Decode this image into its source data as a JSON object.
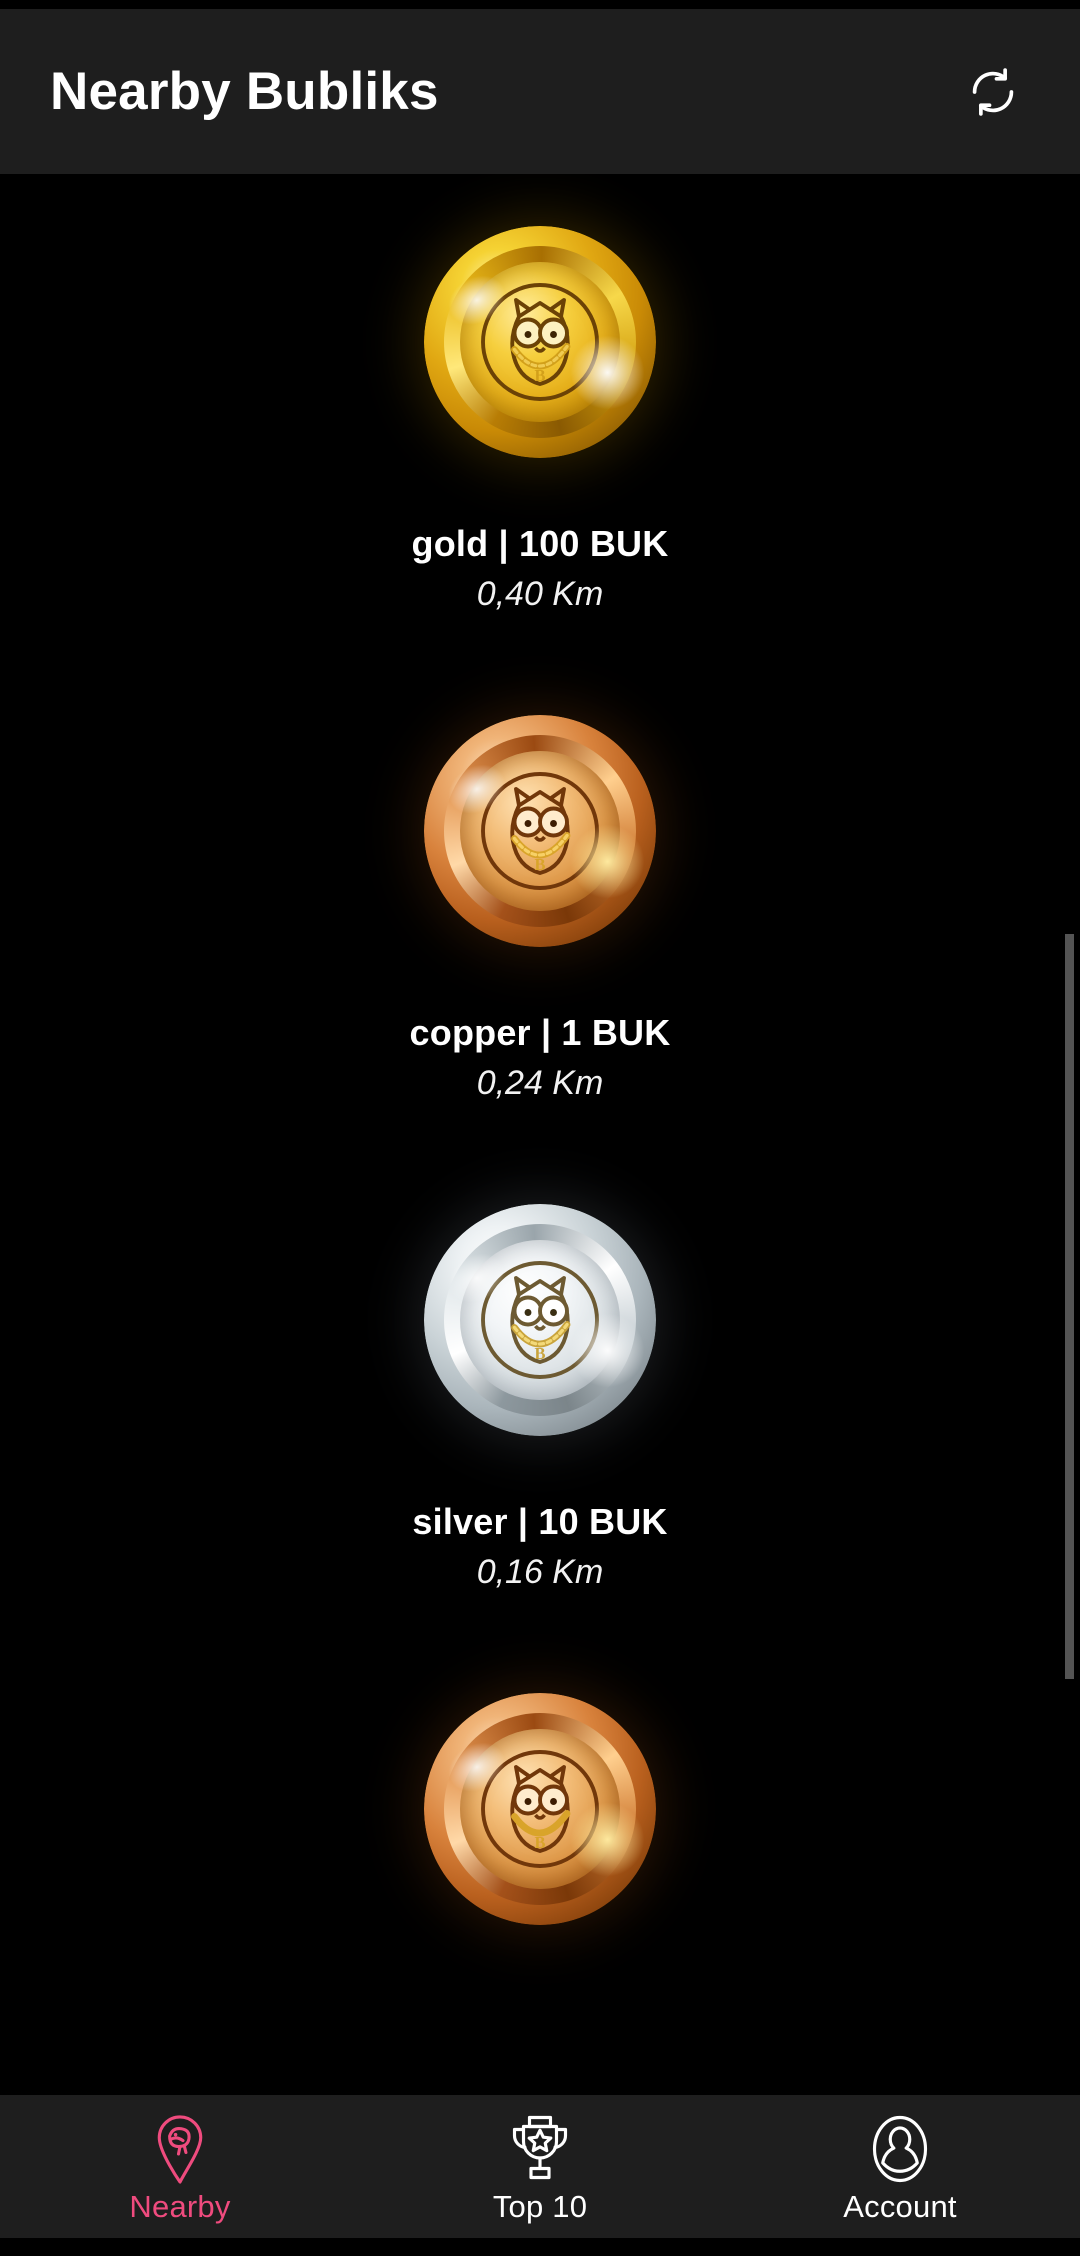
{
  "header": {
    "title": "Nearby Bubliks",
    "refresh_icon": "refresh-icon",
    "background_color": "#1e1e1e",
    "title_color": "#ffffff"
  },
  "colors": {
    "background": "#000000",
    "surface": "#1e1e1e",
    "accent_pink": "#ef4b7e",
    "text_primary": "#ffffff",
    "scrollbar": "#545454",
    "gold": "#f6cf3e",
    "copper": "#e09b4c",
    "silver": "#dde3e6"
  },
  "list": {
    "items": [
      {
        "metal": "gold",
        "title": "gold | 100 BUK",
        "distance": "0,40 Km",
        "icon": "gold-coin-owl-icon",
        "partial": false
      },
      {
        "metal": "copper",
        "title": "copper | 1 BUK",
        "distance": "0,24 Km",
        "icon": "copper-coin-owl-icon",
        "partial": false
      },
      {
        "metal": "silver",
        "title": "silver | 10 BUK",
        "distance": "0,16 Km",
        "icon": "silver-coin-owl-icon",
        "partial": false
      },
      {
        "metal": "copper",
        "title": "",
        "distance": "",
        "icon": "copper-coin-owl-icon",
        "partial": true
      }
    ]
  },
  "scrollbar": {
    "visible": true,
    "color": "#545454"
  },
  "bottom_nav": {
    "items": [
      {
        "label": "Nearby",
        "icon": "map-pin-icon",
        "active": true
      },
      {
        "label": "Top 10",
        "icon": "trophy-icon",
        "active": false
      },
      {
        "label": "Account",
        "icon": "person-icon",
        "active": false
      }
    ]
  }
}
